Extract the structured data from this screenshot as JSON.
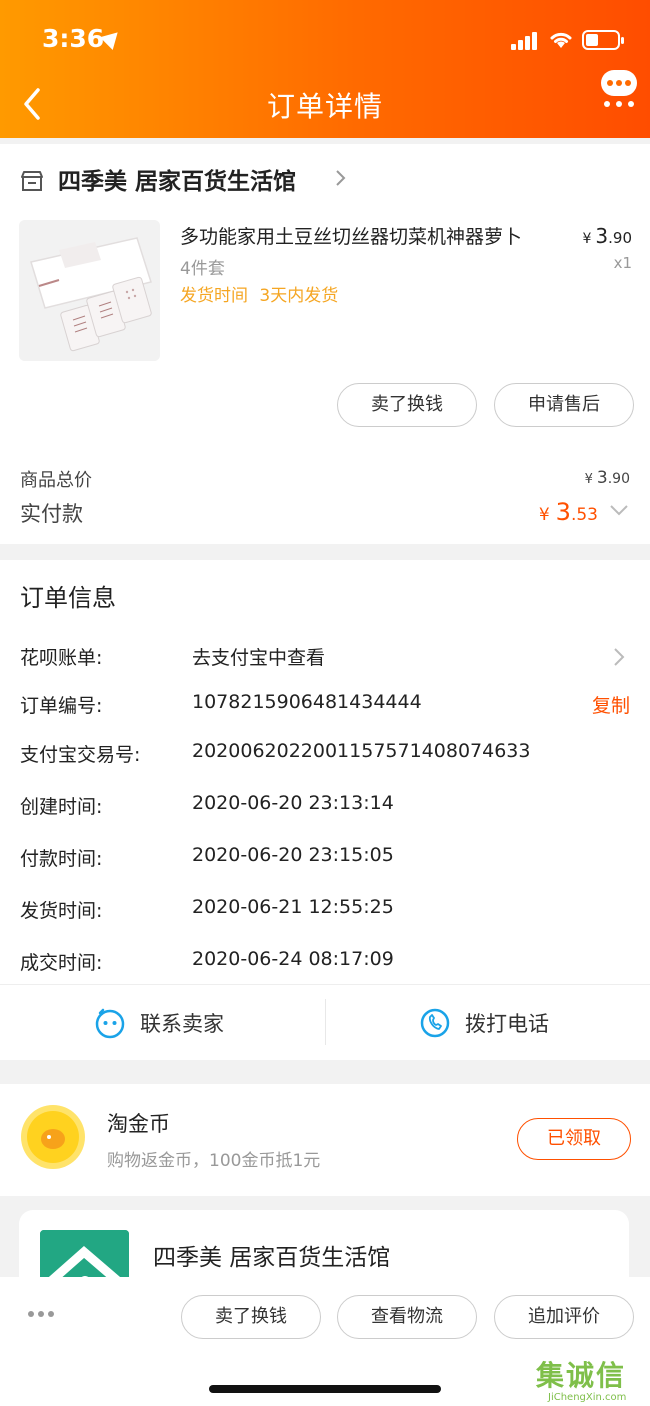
{
  "status_bar": {
    "time": "3:36"
  },
  "header": {
    "title": "订单详情"
  },
  "shop": {
    "name": "四季美 居家百货生活馆"
  },
  "product": {
    "title": "多功能家用土豆丝切丝器切菜机神器萝卜",
    "spec": "4件套",
    "ship_label": "发货时间",
    "ship_value": "3天内发货",
    "price_currency": "¥",
    "price_int": "3",
    "price_dec": ".90",
    "quantity": "x1"
  },
  "actions": {
    "sell": "卖了换钱",
    "after_sale": "申请售后"
  },
  "totals": {
    "goods_label": "商品总价",
    "goods_currency": "¥",
    "goods_int": "3",
    "goods_dec": ".90",
    "paid_label": "实付款",
    "paid_currency": "¥",
    "paid_int": "3",
    "paid_dec": ".53"
  },
  "order_info": {
    "title": "订单信息",
    "rows": [
      {
        "label": "花呗账单:",
        "value": "去支付宝中查看"
      },
      {
        "label": "订单编号:",
        "value": "1078215906481434444",
        "action": "复制"
      },
      {
        "label": "支付宝交易号:",
        "value": "2020062022001157571408074633"
      },
      {
        "label": "创建时间:",
        "value": "2020-06-20 23:13:14"
      },
      {
        "label": "付款时间:",
        "value": "2020-06-20 23:15:05"
      },
      {
        "label": "发货时间:",
        "value": "2020-06-21 12:55:25"
      },
      {
        "label": "成交时间:",
        "value": "2020-06-24 08:17:09"
      }
    ]
  },
  "contact": {
    "seller": "联系卖家",
    "phone": "拨打电话"
  },
  "coin": {
    "title": "淘金币",
    "subtitle": "购物返金币，100金币抵1元",
    "button": "已领取"
  },
  "store_card": {
    "name": "四季美 居家百货生活馆"
  },
  "bottom_bar": {
    "sell": "卖了换钱",
    "logistics": "查看物流",
    "review": "追加评价"
  },
  "watermark": {
    "main": "集诚信",
    "sub": "JiChengXin.com"
  },
  "colors": {
    "accent": "#ff5000",
    "header_start": "#ff9a00",
    "header_end": "#ff4d00",
    "ship": "#f5a623"
  }
}
